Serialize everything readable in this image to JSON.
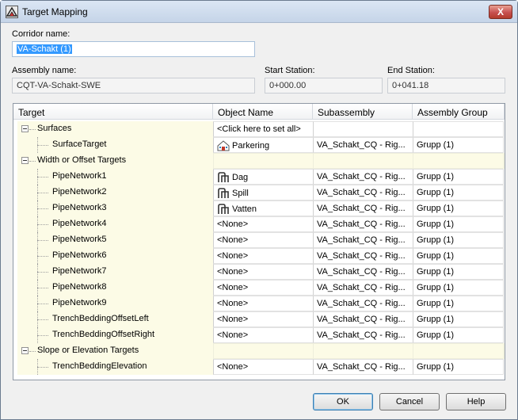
{
  "window": {
    "title": "Target Mapping",
    "close_glyph": "X"
  },
  "corridor": {
    "label": "Corridor name:",
    "value": "VA-Schakt (1)"
  },
  "assembly": {
    "label": "Assembly name:",
    "value": "CQT-VA-Schakt-SWE"
  },
  "start_station": {
    "label": "Start Station:",
    "value": "0+000.00"
  },
  "end_station": {
    "label": "End Station:",
    "value": "0+041.18"
  },
  "grid": {
    "columns": [
      "Target",
      "Object Name",
      "Subassembly",
      "Assembly Group"
    ],
    "rows": [
      {
        "kind": "group",
        "target": "Surfaces",
        "object": "<Click here to set all>",
        "sub": "",
        "grp": ""
      },
      {
        "kind": "item",
        "target": "SurfaceTarget",
        "icon": "surface-icon",
        "object": "Parkering",
        "sub": "VA_Schakt_CQ - Rig...",
        "grp": "Grupp (1)"
      },
      {
        "kind": "group",
        "target": "Width or Offset Targets",
        "object": "",
        "sub": "",
        "grp": ""
      },
      {
        "kind": "item",
        "target": "PipeNetwork1",
        "icon": "pipe-network-icon",
        "object": "Dag",
        "sub": "VA_Schakt_CQ - Rig...",
        "grp": "Grupp (1)"
      },
      {
        "kind": "item",
        "target": "PipeNetwork2",
        "icon": "pipe-network-icon",
        "object": "Spill",
        "sub": "VA_Schakt_CQ - Rig...",
        "grp": "Grupp (1)"
      },
      {
        "kind": "item",
        "target": "PipeNetwork3",
        "icon": "pipe-network-icon",
        "object": "Vatten",
        "sub": "VA_Schakt_CQ - Rig...",
        "grp": "Grupp (1)"
      },
      {
        "kind": "item",
        "target": "PipeNetwork4",
        "object": "<None>",
        "sub": "VA_Schakt_CQ - Rig...",
        "grp": "Grupp (1)"
      },
      {
        "kind": "item",
        "target": "PipeNetwork5",
        "object": "<None>",
        "sub": "VA_Schakt_CQ - Rig...",
        "grp": "Grupp (1)"
      },
      {
        "kind": "item",
        "target": "PipeNetwork6",
        "object": "<None>",
        "sub": "VA_Schakt_CQ - Rig...",
        "grp": "Grupp (1)"
      },
      {
        "kind": "item",
        "target": "PipeNetwork7",
        "object": "<None>",
        "sub": "VA_Schakt_CQ - Rig...",
        "grp": "Grupp (1)"
      },
      {
        "kind": "item",
        "target": "PipeNetwork8",
        "object": "<None>",
        "sub": "VA_Schakt_CQ - Rig...",
        "grp": "Grupp (1)"
      },
      {
        "kind": "item",
        "target": "PipeNetwork9",
        "object": "<None>",
        "sub": "VA_Schakt_CQ - Rig...",
        "grp": "Grupp (1)"
      },
      {
        "kind": "item",
        "target": "TrenchBeddingOffsetLeft",
        "object": "<None>",
        "sub": "VA_Schakt_CQ - Rig...",
        "grp": "Grupp (1)"
      },
      {
        "kind": "item",
        "target": "TrenchBeddingOffsetRight",
        "object": "<None>",
        "sub": "VA_Schakt_CQ - Rig...",
        "grp": "Grupp (1)"
      },
      {
        "kind": "group",
        "target": "Slope or Elevation Targets",
        "object": "",
        "sub": "",
        "grp": ""
      },
      {
        "kind": "item",
        "target": "TrenchBeddingElevation",
        "object": "<None>",
        "sub": "VA_Schakt_CQ - Rig...",
        "grp": "Grupp (1)"
      }
    ]
  },
  "buttons": {
    "ok": "OK",
    "cancel": "Cancel",
    "help": "Help"
  }
}
